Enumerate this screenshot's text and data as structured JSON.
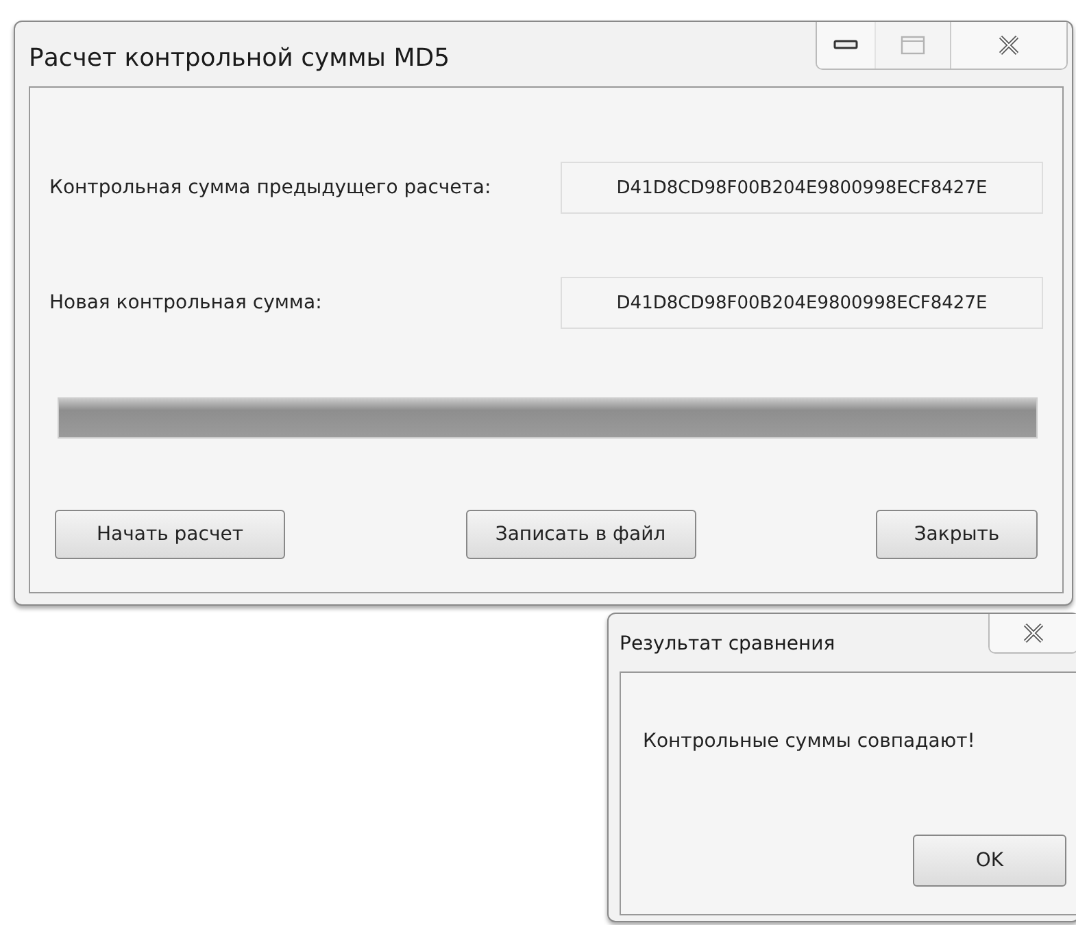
{
  "main_window": {
    "title": "Расчет контрольной суммы MD5",
    "window_buttons": [
      {
        "kind": "minimize",
        "disabled": false
      },
      {
        "kind": "maximize",
        "disabled": true
      },
      {
        "kind": "close",
        "disabled": false
      }
    ],
    "fields": [
      {
        "label": "Контрольная сумма предыдущего расчета:",
        "value": "D41D8CD98F00B204E9800998ECF8427E"
      },
      {
        "label": "Новая контрольная сумма:",
        "value": "D41D8CD98F00B204E9800998ECF8427E"
      }
    ],
    "progress": {
      "level": 1
    },
    "buttons": [
      "Начать расчет",
      "Записать в файл",
      "Закрыть"
    ]
  },
  "result_dialog": {
    "title": "Результат сравнения",
    "message": "Контрольные суммы совпадают!",
    "buttons": [
      "OK"
    ]
  }
}
